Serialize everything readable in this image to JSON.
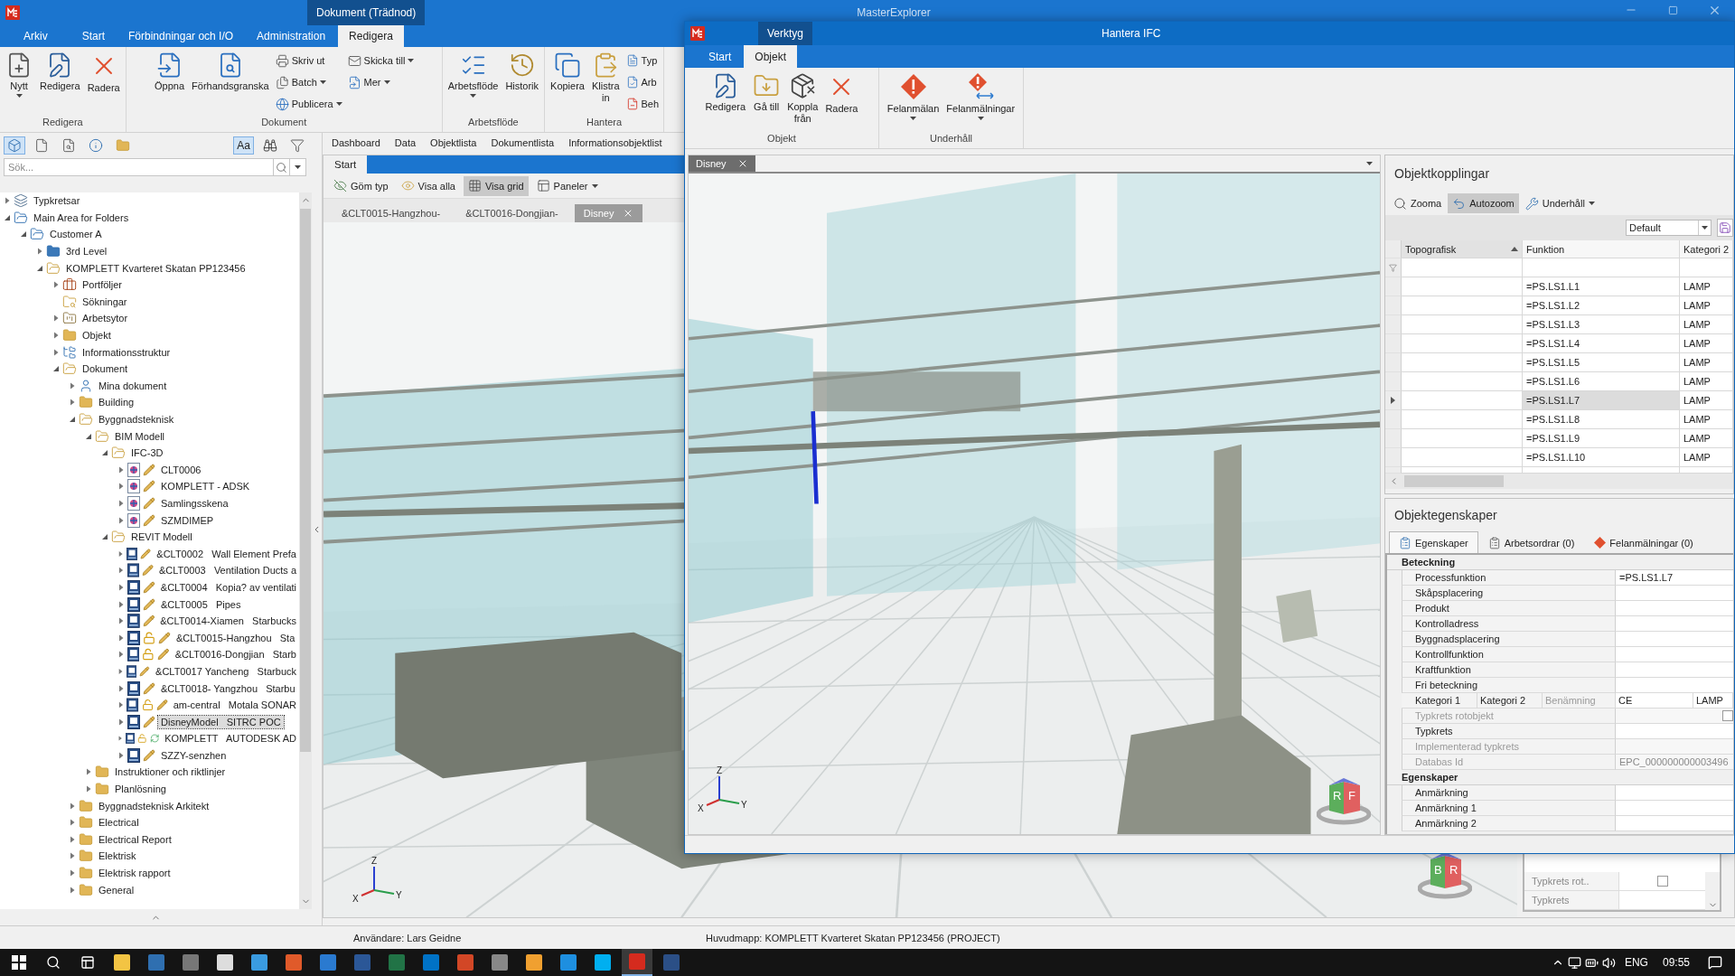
{
  "main_window": {
    "title": "MasterExplorer",
    "context_tab": "Dokument (Trädnod)",
    "file_tab": "Arkiv",
    "tabs": [
      {
        "label": "Start",
        "selected": false
      },
      {
        "label": "Förbindningar och I/O",
        "selected": false
      },
      {
        "label": "Administration",
        "selected": false
      },
      {
        "label": "Redigera",
        "selected": true
      }
    ],
    "ribbon_groups": [
      {
        "label": "Redigera",
        "items": [
          {
            "kind": "large",
            "label": "Nytt",
            "dropdown": true
          },
          {
            "kind": "large",
            "label": "Redigera",
            "dropdown": false
          },
          {
            "kind": "large",
            "label": "Radera",
            "dropdown": false
          }
        ]
      },
      {
        "label": "Dokument",
        "items": [
          {
            "kind": "large",
            "label": "Öppna",
            "dropdown": false
          },
          {
            "kind": "large",
            "label": "Förhandsgranska",
            "dropdown": false
          },
          {
            "kind": "small",
            "label": "Skriv ut",
            "dropdown": false
          },
          {
            "kind": "small",
            "label": "Batch",
            "dropdown": true
          },
          {
            "kind": "small",
            "label": "Publicera",
            "dropdown": true
          },
          {
            "kind": "small",
            "label": "Skicka till",
            "dropdown": true
          },
          {
            "kind": "small",
            "label": "Mer",
            "dropdown": true
          }
        ]
      },
      {
        "label": "Arbetsflöde",
        "items": [
          {
            "kind": "large",
            "label": "Arbetsflöde",
            "dropdown": true
          },
          {
            "kind": "large",
            "label": "Historik",
            "dropdown": false
          }
        ]
      },
      {
        "label": "Hantera",
        "items": [
          {
            "kind": "large",
            "label": "Kopiera",
            "dropdown": false
          },
          {
            "kind": "large",
            "label": "Klistra\nin",
            "dropdown": false
          },
          {
            "kind": "small",
            "label": "Typ",
            "dropdown": false
          },
          {
            "kind": "small",
            "label": "Arb",
            "dropdown": false
          },
          {
            "kind": "small",
            "label": "Beh",
            "dropdown": false
          }
        ]
      }
    ],
    "left_panel": {
      "view_buttons": [
        {
          "selected": true
        },
        {
          "selected": false
        },
        {
          "selected": false
        },
        {
          "selected": false
        },
        {
          "selected": false
        }
      ],
      "text_toggle": {
        "label": "Aa",
        "selected": true
      },
      "search": {
        "placeholder": "Sök..."
      },
      "tree": [
        {
          "label": "Typkretsar",
          "kind": "typkrets",
          "expanded": false,
          "selected": false
        },
        {
          "label": "Main Area for Folders",
          "kind": "area",
          "expanded": true,
          "selected": false,
          "children": [
            {
              "label": "Customer A",
              "kind": "area",
              "expanded": true,
              "selected": false,
              "children": [
                {
                  "label": "3rd Level",
                  "kind": "blue-folder",
                  "expanded": false,
                  "selected": false
                },
                {
                  "label": "KOMPLETT Kvarteret Skatan PP123456",
                  "kind": "folder",
                  "expanded": true,
                  "selected": false,
                  "children": [
                    {
                      "label": "Portföljer",
                      "kind": "portfolio",
                      "expanded": false,
                      "selected": false
                    },
                    {
                      "label": "Sökningar",
                      "kind": "search",
                      "selected": false
                    },
                    {
                      "label": "Arbetsytor",
                      "kind": "workspace",
                      "expanded": false,
                      "selected": false
                    },
                    {
                      "label": "Objekt",
                      "kind": "folder",
                      "expanded": false,
                      "selected": false
                    },
                    {
                      "label": "Informationsstruktur",
                      "kind": "info",
                      "expanded": false,
                      "selected": false
                    },
                    {
                      "label": "Dokument",
                      "kind": "docs",
                      "expanded": true,
                      "selected": false,
                      "children": [
                        {
                          "label": "Mina dokument",
                          "kind": "mydocs",
                          "expanded": false,
                          "selected": false
                        },
                        {
                          "label": "Building",
                          "kind": "folder",
                          "expanded": false,
                          "selected": false
                        },
                        {
                          "label": "Byggnadsteknisk",
                          "kind": "folder",
                          "expanded": true,
                          "selected": false,
                          "children": [
                            {
                              "label": "BIM Modell",
                              "kind": "folder",
                              "expanded": true,
                              "selected": false,
                              "children": [
                                {
                                  "label": "IFC-3D",
                                  "kind": "folder",
                                  "expanded": true,
                                  "selected": false,
                                  "children": [
                                    {
                                      "label": "CLT0006",
                                      "kind": "ifc",
                                      "expanded": false,
                                      "selected": false,
                                      "locked": false,
                                      "editing": true,
                                      "synced": false
                                    },
                                    {
                                      "label": "KOMPLETT - ADSK",
                                      "kind": "ifc",
                                      "expanded": false,
                                      "selected": false,
                                      "locked": false,
                                      "editing": true,
                                      "synced": false
                                    },
                                    {
                                      "label": "Samlingsskena",
                                      "kind": "ifc",
                                      "expanded": false,
                                      "selected": false,
                                      "locked": false,
                                      "editing": true,
                                      "synced": false
                                    },
                                    {
                                      "label": "SZMDIMEP",
                                      "kind": "ifc",
                                      "expanded": false,
                                      "selected": false,
                                      "locked": false,
                                      "editing": true,
                                      "synced": false
                                    }
                                  ]
                                },
                                {
                                  "label": "REVIT Modell",
                                  "kind": "folder",
                                  "expanded": true,
                                  "selected": false,
                                  "children": [
                                    {
                                      "label": "&CLT0002   Wall Element Prefa",
                                      "kind": "revit",
                                      "expanded": false,
                                      "selected": false,
                                      "locked": false,
                                      "editing": true,
                                      "synced": false
                                    },
                                    {
                                      "label": "&CLT0003   Ventilation Ducts a",
                                      "kind": "revit",
                                      "expanded": false,
                                      "selected": false,
                                      "locked": false,
                                      "editing": true,
                                      "synced": false
                                    },
                                    {
                                      "label": "&CLT0004   Kopia? av ventilati",
                                      "kind": "revit",
                                      "expanded": false,
                                      "selected": false,
                                      "locked": false,
                                      "editing": true,
                                      "synced": false
                                    },
                                    {
                                      "label": "&CLT0005   Pipes",
                                      "kind": "revit",
                                      "expanded": false,
                                      "selected": false,
                                      "locked": false,
                                      "editing": true,
                                      "synced": false
                                    },
                                    {
                                      "label": "&CLT0014-Xiamen   Starbucks",
                                      "kind": "revit",
                                      "expanded": false,
                                      "selected": false,
                                      "locked": false,
                                      "editing": true,
                                      "synced": false
                                    },
                                    {
                                      "label": "&CLT0015-Hangzhou   Sta",
                                      "kind": "revit",
                                      "expanded": false,
                                      "selected": false,
                                      "locked": true,
                                      "editing": true,
                                      "synced": false
                                    },
                                    {
                                      "label": "&CLT0016-Dongjian   Starb",
                                      "kind": "revit",
                                      "expanded": false,
                                      "selected": false,
                                      "locked": true,
                                      "editing": true,
                                      "synced": false
                                    },
                                    {
                                      "label": "&CLT0017 Yancheng   Starbuck",
                                      "kind": "revit",
                                      "expanded": false,
                                      "selected": false,
                                      "locked": false,
                                      "editing": true,
                                      "synced": false
                                    },
                                    {
                                      "label": "&CLT0018- Yangzhou   Starbu",
                                      "kind": "revit",
                                      "expanded": false,
                                      "selected": false,
                                      "locked": false,
                                      "editing": true,
                                      "synced": false
                                    },
                                    {
                                      "label": "am-central   Motala SONAR",
                                      "kind": "revit",
                                      "expanded": false,
                                      "selected": false,
                                      "locked": true,
                                      "editing": true,
                                      "synced": false
                                    },
                                    {
                                      "label": "DisneyModel   SITRC POC",
                                      "kind": "revit",
                                      "expanded": false,
                                      "selected": true,
                                      "locked": false,
                                      "editing": true,
                                      "synced": false
                                    },
                                    {
                                      "label": "KOMPLETT   AUTODESK AD",
                                      "kind": "revit",
                                      "expanded": false,
                                      "selected": false,
                                      "locked": true,
                                      "editing": false,
                                      "synced": true
                                    },
                                    {
                                      "label": "SZZY-senzhen",
                                      "kind": "revit",
                                      "expanded": false,
                                      "selected": false,
                                      "locked": false,
                                      "editing": true,
                                      "synced": false
                                    }
                                  ]
                                }
                              ]
                            },
                            {
                              "label": "Instruktioner och riktlinjer",
                              "kind": "folder",
                              "expanded": false,
                              "selected": false
                            },
                            {
                              "label": "Planlösning",
                              "kind": "folder",
                              "expanded": false,
                              "selected": false
                            }
                          ]
                        },
                        {
                          "label": "Byggnadsteknisk Arkitekt",
                          "kind": "folder",
                          "expanded": false,
                          "selected": false
                        },
                        {
                          "label": "Electrical",
                          "kind": "folder",
                          "expanded": false,
                          "selected": false
                        },
                        {
                          "label": "Electrical Report",
                          "kind": "folder",
                          "expanded": false,
                          "selected": false
                        },
                        {
                          "label": "Elektrisk",
                          "kind": "folder",
                          "expanded": false,
                          "selected": false
                        },
                        {
                          "label": "Elektrisk rapport",
                          "kind": "folder",
                          "expanded": false,
                          "selected": false
                        },
                        {
                          "label": "General",
                          "kind": "folder",
                          "expanded": false,
                          "selected": false
                        }
                      ]
                    }
                  ]
                }
              ]
            }
          ]
        }
      ]
    },
    "view_tabs": [
      {
        "label": "Dashboard",
        "selected": false
      },
      {
        "label": "Data",
        "selected": false
      },
      {
        "label": "Objektlista",
        "selected": false
      },
      {
        "label": "Dokumentlista",
        "selected": false
      },
      {
        "label": "Informationsobjektlist",
        "selected": false
      }
    ],
    "viewer": {
      "header": "Start",
      "toolbar": [
        {
          "label": "Göm typ",
          "selected": false,
          "dropdown": false
        },
        {
          "label": "Visa alla",
          "selected": false,
          "dropdown": false
        },
        {
          "label": "Visa grid",
          "selected": true,
          "dropdown": false
        },
        {
          "label": "Paneler",
          "selected": false,
          "dropdown": true
        }
      ],
      "doc_tabs": [
        {
          "label": "&CLT0015-Hangzhou-",
          "selected": false,
          "closable": false
        },
        {
          "label": "&CLT0016-Dongjian-",
          "selected": false,
          "closable": false
        },
        {
          "label": "Disney",
          "selected": true,
          "closable": true
        }
      ],
      "axes": {
        "z": "Z",
        "y": "Y",
        "x": "X"
      },
      "view_cube": [
        "B",
        "R"
      ],
      "side_properties": [
        {
          "kind": "checkbox",
          "label": "Typkrets rot..",
          "checked": false
        },
        {
          "kind": "text",
          "label": "Typkrets"
        }
      ]
    }
  },
  "ifc_window": {
    "title": "Hantera IFC",
    "context_tab": "Verktyg",
    "tabs": [
      {
        "label": "Start",
        "selected": false
      },
      {
        "label": "Objekt",
        "selected": true
      }
    ],
    "ribbon_groups": [
      {
        "label": "Objekt",
        "items": [
          {
            "kind": "large",
            "label": "Redigera",
            "dropdown": false
          },
          {
            "kind": "large",
            "label": "Gå till",
            "dropdown": false
          },
          {
            "kind": "large",
            "label": "Koppla\nfrån",
            "dropdown": false
          },
          {
            "kind": "large",
            "label": "Radera",
            "dropdown": false
          }
        ]
      },
      {
        "label": "Underhåll",
        "items": [
          {
            "kind": "large",
            "label": "Felanmälan",
            "dropdown": true
          },
          {
            "kind": "large",
            "label": "Felanmälningar",
            "dropdown": true
          }
        ]
      }
    ],
    "viewer": {
      "tabs": [
        {
          "label": "Disney",
          "selected": true,
          "closable": true
        }
      ],
      "axes": {
        "z": "Z",
        "y": "Y",
        "x": "X"
      },
      "view_cube": [
        "R",
        "F"
      ]
    },
    "links": {
      "title": "Objektkopplingar",
      "toolbar": [
        {
          "label": "Zooma",
          "selected": false,
          "dropdown": false
        },
        {
          "label": "Autozoom",
          "selected": true,
          "dropdown": false
        },
        {
          "label": "Underhåll",
          "selected": false,
          "dropdown": true
        }
      ],
      "layout": "Default",
      "columns": [
        {
          "label": "Topografisk",
          "sorted": true
        },
        {
          "label": "Funktion",
          "sorted": false
        },
        {
          "label": "Kategori 2",
          "sorted": false
        }
      ],
      "rows": [
        {
          "function": "=PS.LS1.L1",
          "category": "LAMP",
          "selected": false
        },
        {
          "function": "=PS.LS1.L2",
          "category": "LAMP",
          "selected": false
        },
        {
          "function": "=PS.LS1.L3",
          "category": "LAMP",
          "selected": false
        },
        {
          "function": "=PS.LS1.L4",
          "category": "LAMP",
          "selected": false
        },
        {
          "function": "=PS.LS1.L5",
          "category": "LAMP",
          "selected": false
        },
        {
          "function": "=PS.LS1.L6",
          "category": "LAMP",
          "selected": false
        },
        {
          "function": "=PS.LS1.L7",
          "category": "LAMP",
          "selected": true
        },
        {
          "function": "=PS.LS1.L8",
          "category": "LAMP",
          "selected": false
        },
        {
          "function": "=PS.LS1.L9",
          "category": "LAMP",
          "selected": false
        },
        {
          "function": "=PS.LS1.L10",
          "category": "LAMP",
          "selected": false
        }
      ]
    },
    "properties": {
      "title": "Objektegenskaper",
      "tabs": [
        {
          "label": "Egenskaper",
          "selected": true
        },
        {
          "label": "Arbetsordrar (0)",
          "selected": false
        },
        {
          "label": "Felanmälningar (0)",
          "selected": false
        }
      ],
      "categories": [
        {
          "label": "Beteckning",
          "rows": [
            {
              "kind": "text",
              "label": "Processfunktion",
              "value": "=PS.LS1.L7",
              "disabled": false
            },
            {
              "kind": "text",
              "label": "Skåpsplacering",
              "disabled": false
            },
            {
              "kind": "text",
              "label": "Produkt",
              "disabled": false
            },
            {
              "kind": "text",
              "label": "Kontrolladress",
              "disabled": false
            },
            {
              "kind": "text",
              "label": "Byggnadsplacering",
              "disabled": false
            },
            {
              "kind": "text",
              "label": "Kontrollfunktion",
              "disabled": false
            },
            {
              "kind": "text",
              "label": "Kraftfunktion",
              "disabled": false
            },
            {
              "kind": "text",
              "label": "Fri beteckning",
              "disabled": false
            },
            {
              "kind": "split",
              "labels": [
                {
                  "text": "Kategori 1",
                  "disabled": false
                },
                {
                  "text": "Kategori 2",
                  "disabled": false
                },
                {
                  "text": "Benämning",
                  "disabled": true
                }
              ],
              "values": [
                "CE",
                "LAMP"
              ]
            },
            {
              "kind": "checkbox",
              "label": "Typkrets rotobjekt",
              "checked": false,
              "disabled": true
            },
            {
              "kind": "text",
              "label": "Typkrets",
              "disabled": false
            },
            {
              "kind": "text",
              "label": "Implementerad typkrets",
              "disabled": true
            },
            {
              "kind": "text",
              "label": "Databas Id",
              "value": "EPC_000000000003496",
              "disabled": true
            }
          ]
        },
        {
          "label": "Egenskaper",
          "rows": [
            {
              "kind": "text",
              "label": "Anmärkning",
              "disabled": false
            },
            {
              "kind": "text",
              "label": "Anmärkning 1",
              "disabled": false
            },
            {
              "kind": "text",
              "label": "Anmärkning 2",
              "disabled": false
            }
          ]
        }
      ]
    }
  },
  "status_bar": {
    "user": "Användare: Lars Geidne",
    "root_folder": "Huvudmapp: KOMPLETT Kvarteret Skatan PP123456 (PROJECT)"
  },
  "taskbar": {
    "language": "ENG",
    "time": "09:55"
  }
}
